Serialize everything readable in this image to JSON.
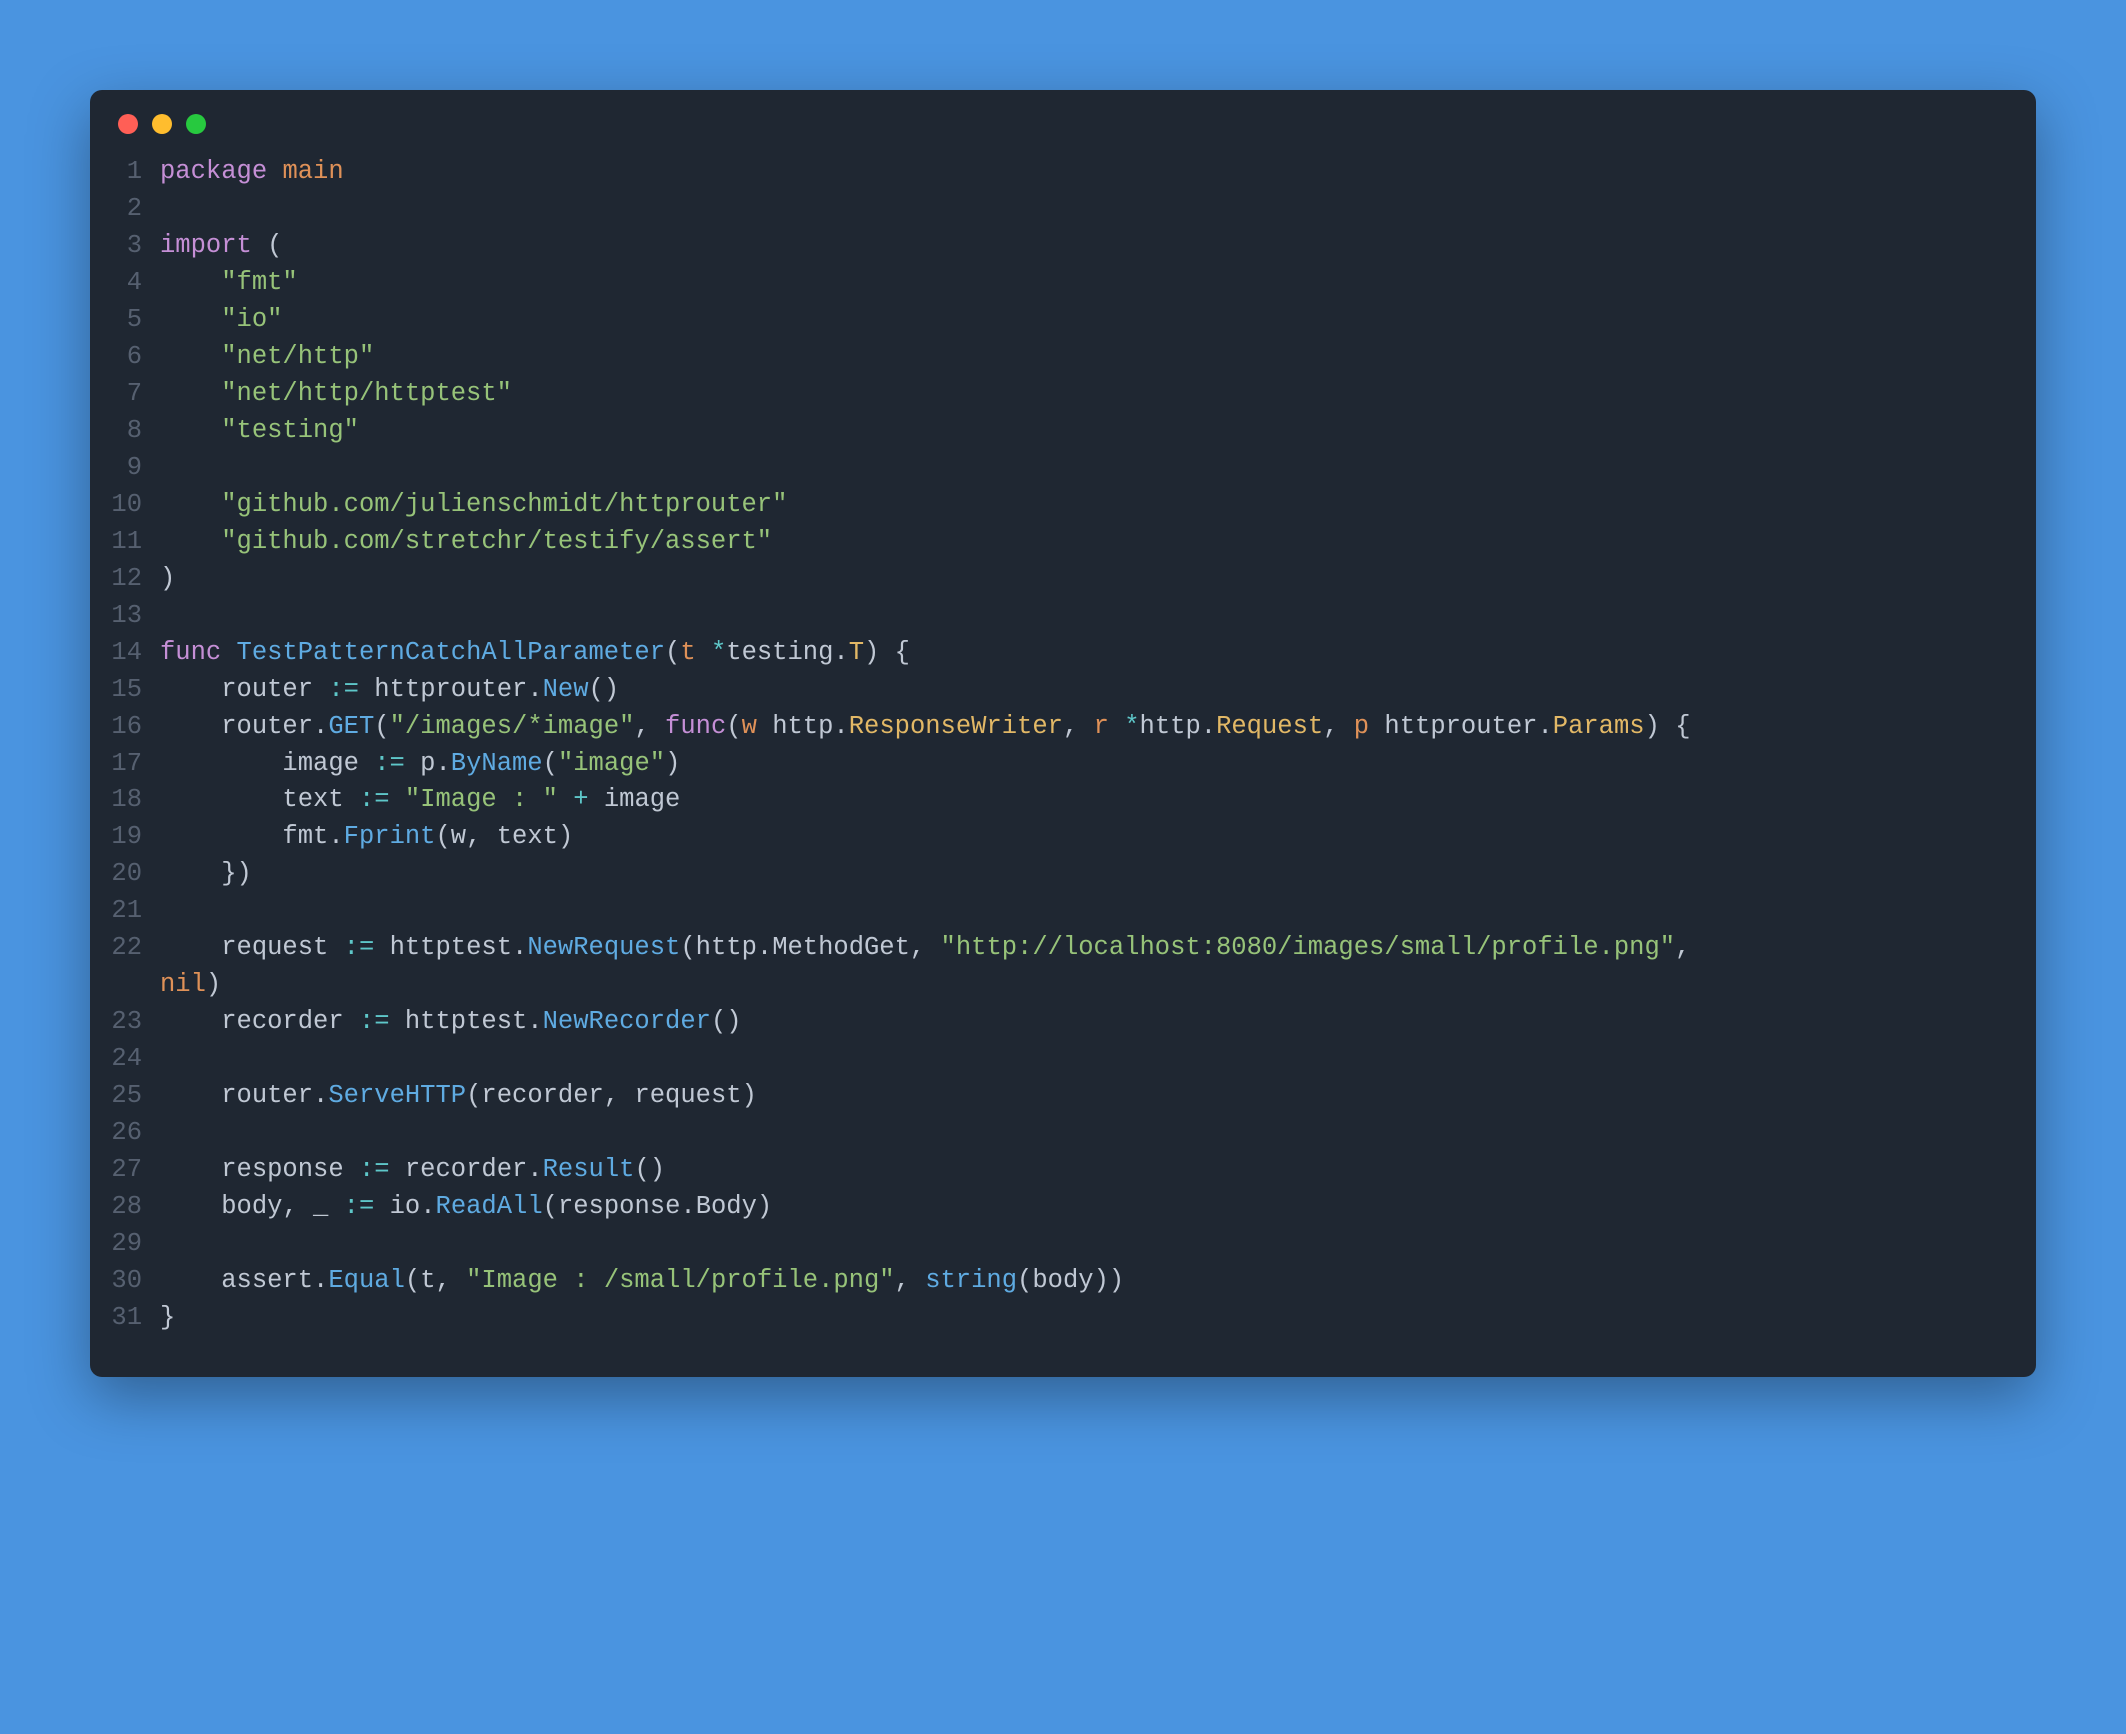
{
  "window": {
    "traffic_lights": [
      "red",
      "yellow",
      "green"
    ]
  },
  "code": {
    "lines": [
      {
        "n": 1,
        "tokens": [
          [
            "kw",
            "package"
          ],
          [
            "sp",
            " "
          ],
          [
            "orange",
            "main"
          ]
        ]
      },
      {
        "n": 2,
        "tokens": []
      },
      {
        "n": 3,
        "tokens": [
          [
            "kw",
            "import"
          ],
          [
            "sp",
            " "
          ],
          [
            "paren",
            "("
          ]
        ]
      },
      {
        "n": 4,
        "tokens": [
          [
            "sp",
            "    "
          ],
          [
            "str",
            "\"fmt\""
          ]
        ]
      },
      {
        "n": 5,
        "tokens": [
          [
            "sp",
            "    "
          ],
          [
            "str",
            "\"io\""
          ]
        ]
      },
      {
        "n": 6,
        "tokens": [
          [
            "sp",
            "    "
          ],
          [
            "str",
            "\"net/http\""
          ]
        ]
      },
      {
        "n": 7,
        "tokens": [
          [
            "sp",
            "    "
          ],
          [
            "str",
            "\"net/http/httptest\""
          ]
        ]
      },
      {
        "n": 8,
        "tokens": [
          [
            "sp",
            "    "
          ],
          [
            "str",
            "\"testing\""
          ]
        ]
      },
      {
        "n": 9,
        "tokens": []
      },
      {
        "n": 10,
        "tokens": [
          [
            "sp",
            "    "
          ],
          [
            "str",
            "\"github.com/julienschmidt/httprouter\""
          ]
        ]
      },
      {
        "n": 11,
        "tokens": [
          [
            "sp",
            "    "
          ],
          [
            "str",
            "\"github.com/stretchr/testify/assert\""
          ]
        ]
      },
      {
        "n": 12,
        "tokens": [
          [
            "paren",
            ")"
          ]
        ]
      },
      {
        "n": 13,
        "tokens": []
      },
      {
        "n": 14,
        "tokens": [
          [
            "kw",
            "func"
          ],
          [
            "sp",
            " "
          ],
          [
            "fn",
            "TestPatternCatchAllParameter"
          ],
          [
            "paren",
            "("
          ],
          [
            "var",
            "t"
          ],
          [
            "sp",
            " "
          ],
          [
            "op",
            "*"
          ],
          [
            "ident",
            "testing"
          ],
          [
            "dot-op",
            "."
          ],
          [
            "type",
            "T"
          ],
          [
            "paren",
            ")"
          ],
          [
            "sp",
            " "
          ],
          [
            "brace",
            "{"
          ]
        ]
      },
      {
        "n": 15,
        "tokens": [
          [
            "sp",
            "    "
          ],
          [
            "ident",
            "router"
          ],
          [
            "sp",
            " "
          ],
          [
            "op",
            ":="
          ],
          [
            "sp",
            " "
          ],
          [
            "ident",
            "httprouter"
          ],
          [
            "dot-op",
            "."
          ],
          [
            "fn",
            "New"
          ],
          [
            "paren",
            "()"
          ]
        ]
      },
      {
        "n": 16,
        "tokens": [
          [
            "sp",
            "    "
          ],
          [
            "ident",
            "router"
          ],
          [
            "dot-op",
            "."
          ],
          [
            "fn",
            "GET"
          ],
          [
            "paren",
            "("
          ],
          [
            "str",
            "\"/images/*image\""
          ],
          [
            "ident",
            ", "
          ],
          [
            "kw",
            "func"
          ],
          [
            "paren",
            "("
          ],
          [
            "var",
            "w"
          ],
          [
            "sp",
            " "
          ],
          [
            "ident",
            "http"
          ],
          [
            "dot-op",
            "."
          ],
          [
            "type",
            "ResponseWriter"
          ],
          [
            "ident",
            ", "
          ],
          [
            "var",
            "r"
          ],
          [
            "sp",
            " "
          ],
          [
            "op",
            "*"
          ],
          [
            "ident",
            "http"
          ],
          [
            "dot-op",
            "."
          ],
          [
            "type",
            "Request"
          ],
          [
            "ident",
            ", "
          ],
          [
            "var",
            "p"
          ],
          [
            "sp",
            " "
          ],
          [
            "ident",
            "httprouter"
          ],
          [
            "dot-op",
            "."
          ],
          [
            "type",
            "Params"
          ],
          [
            "paren",
            ")"
          ],
          [
            "sp",
            " "
          ],
          [
            "brace",
            "{"
          ]
        ]
      },
      {
        "n": 17,
        "tokens": [
          [
            "sp",
            "        "
          ],
          [
            "ident",
            "image"
          ],
          [
            "sp",
            " "
          ],
          [
            "op",
            ":="
          ],
          [
            "sp",
            " "
          ],
          [
            "ident",
            "p"
          ],
          [
            "dot-op",
            "."
          ],
          [
            "fn",
            "ByName"
          ],
          [
            "paren",
            "("
          ],
          [
            "str",
            "\"image\""
          ],
          [
            "paren",
            ")"
          ]
        ]
      },
      {
        "n": 18,
        "tokens": [
          [
            "sp",
            "        "
          ],
          [
            "ident",
            "text"
          ],
          [
            "sp",
            " "
          ],
          [
            "op",
            ":="
          ],
          [
            "sp",
            " "
          ],
          [
            "str",
            "\"Image : \""
          ],
          [
            "sp",
            " "
          ],
          [
            "op",
            "+"
          ],
          [
            "sp",
            " "
          ],
          [
            "ident",
            "image"
          ]
        ]
      },
      {
        "n": 19,
        "tokens": [
          [
            "sp",
            "        "
          ],
          [
            "ident",
            "fmt"
          ],
          [
            "dot-op",
            "."
          ],
          [
            "fn",
            "Fprint"
          ],
          [
            "paren",
            "("
          ],
          [
            "ident",
            "w"
          ],
          [
            "ident",
            ", "
          ],
          [
            "ident",
            "text"
          ],
          [
            "paren",
            ")"
          ]
        ]
      },
      {
        "n": 20,
        "tokens": [
          [
            "sp",
            "    "
          ],
          [
            "brace",
            "}"
          ],
          [
            "paren",
            ")"
          ]
        ]
      },
      {
        "n": 21,
        "tokens": []
      },
      {
        "n": 22,
        "tokens": [
          [
            "sp",
            "    "
          ],
          [
            "ident",
            "request"
          ],
          [
            "sp",
            " "
          ],
          [
            "op",
            ":="
          ],
          [
            "sp",
            " "
          ],
          [
            "ident",
            "httptest"
          ],
          [
            "dot-op",
            "."
          ],
          [
            "fn",
            "NewRequest"
          ],
          [
            "paren",
            "("
          ],
          [
            "ident",
            "http"
          ],
          [
            "dot-op",
            "."
          ],
          [
            "ident",
            "MethodGet"
          ],
          [
            "ident",
            ", "
          ],
          [
            "str",
            "\"http://localhost:8080/images/small/profile.png\""
          ],
          [
            "ident",
            ", "
          ]
        ],
        "wrap": [
          [
            "orange",
            "nil"
          ],
          [
            "paren",
            ")"
          ]
        ]
      },
      {
        "n": 23,
        "tokens": [
          [
            "sp",
            "    "
          ],
          [
            "ident",
            "recorder"
          ],
          [
            "sp",
            " "
          ],
          [
            "op",
            ":="
          ],
          [
            "sp",
            " "
          ],
          [
            "ident",
            "httptest"
          ],
          [
            "dot-op",
            "."
          ],
          [
            "fn",
            "NewRecorder"
          ],
          [
            "paren",
            "()"
          ]
        ]
      },
      {
        "n": 24,
        "tokens": []
      },
      {
        "n": 25,
        "tokens": [
          [
            "sp",
            "    "
          ],
          [
            "ident",
            "router"
          ],
          [
            "dot-op",
            "."
          ],
          [
            "fn",
            "ServeHTTP"
          ],
          [
            "paren",
            "("
          ],
          [
            "ident",
            "recorder"
          ],
          [
            "ident",
            ", "
          ],
          [
            "ident",
            "request"
          ],
          [
            "paren",
            ")"
          ]
        ]
      },
      {
        "n": 26,
        "tokens": []
      },
      {
        "n": 27,
        "tokens": [
          [
            "sp",
            "    "
          ],
          [
            "ident",
            "response"
          ],
          [
            "sp",
            " "
          ],
          [
            "op",
            ":="
          ],
          [
            "sp",
            " "
          ],
          [
            "ident",
            "recorder"
          ],
          [
            "dot-op",
            "."
          ],
          [
            "fn",
            "Result"
          ],
          [
            "paren",
            "()"
          ]
        ]
      },
      {
        "n": 28,
        "tokens": [
          [
            "sp",
            "    "
          ],
          [
            "ident",
            "body"
          ],
          [
            "ident",
            ", "
          ],
          [
            "ident",
            "_"
          ],
          [
            "sp",
            " "
          ],
          [
            "op",
            ":="
          ],
          [
            "sp",
            " "
          ],
          [
            "ident",
            "io"
          ],
          [
            "dot-op",
            "."
          ],
          [
            "fn",
            "ReadAll"
          ],
          [
            "paren",
            "("
          ],
          [
            "ident",
            "response"
          ],
          [
            "dot-op",
            "."
          ],
          [
            "ident",
            "Body"
          ],
          [
            "paren",
            ")"
          ]
        ]
      },
      {
        "n": 29,
        "tokens": []
      },
      {
        "n": 30,
        "tokens": [
          [
            "sp",
            "    "
          ],
          [
            "ident",
            "assert"
          ],
          [
            "dot-op",
            "."
          ],
          [
            "fn",
            "Equal"
          ],
          [
            "paren",
            "("
          ],
          [
            "ident",
            "t"
          ],
          [
            "ident",
            ", "
          ],
          [
            "str",
            "\"Image : /small/profile.png\""
          ],
          [
            "ident",
            ", "
          ],
          [
            "fn",
            "string"
          ],
          [
            "paren",
            "("
          ],
          [
            "ident",
            "body"
          ],
          [
            "paren",
            "))"
          ]
        ]
      },
      {
        "n": 31,
        "tokens": [
          [
            "brace",
            "}"
          ]
        ]
      }
    ]
  }
}
